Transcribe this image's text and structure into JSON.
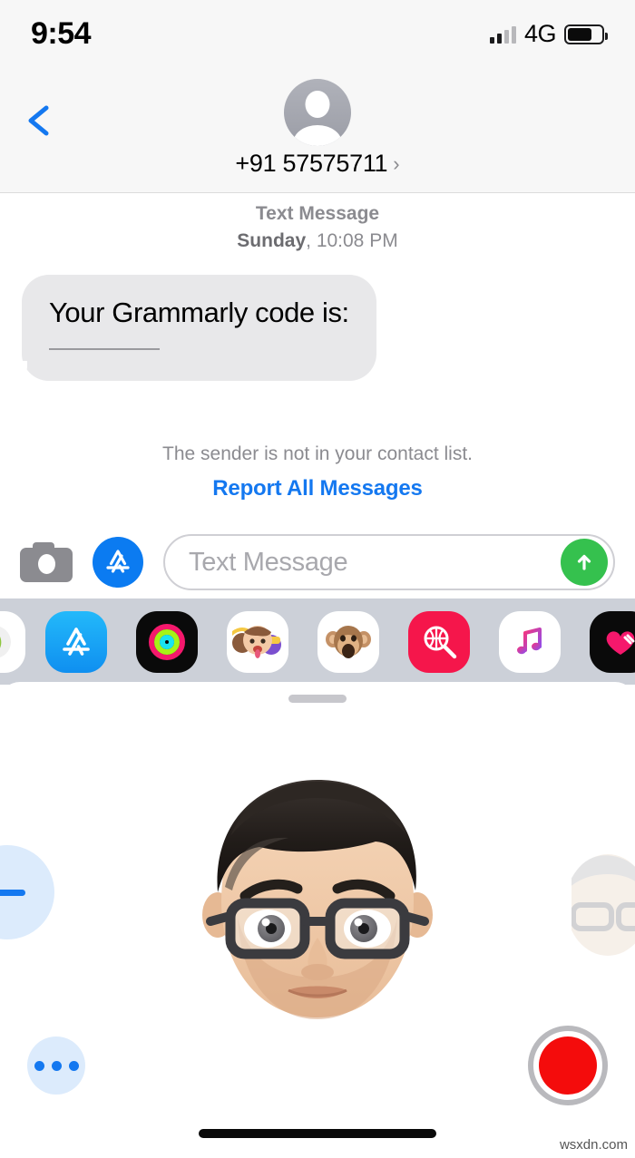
{
  "statusbar": {
    "time": "9:54",
    "network": "4G",
    "signal_bars_active": 2,
    "signal_bars_total": 4,
    "battery_percent": 72,
    "signal_icon": "cellular-signal-icon",
    "battery_icon": "battery-icon"
  },
  "navbar": {
    "back_icon": "back-chevron-icon",
    "avatar_icon": "contact-avatar-placeholder-icon",
    "contact_name": "+91 57575711",
    "detail_arrow": "›"
  },
  "conversation": {
    "message_kind": "Text Message",
    "day": "Sunday",
    "time_separator": ", ",
    "time": "10:08 PM",
    "bubble_text": "Your Grammarly code is:",
    "redacted": true,
    "notice": "The sender is not in your contact list.",
    "report_link": "Report All Messages"
  },
  "inputbar": {
    "camera_icon": "camera-icon",
    "appstore_icon": "app-store-icon",
    "placeholder": "Text Message",
    "value": "",
    "send_icon": "send-arrow-up-icon"
  },
  "appdrawer": {
    "items": [
      {
        "name": "app-icon-partial-left",
        "label": "",
        "bg": "#ffffff",
        "glyph": "",
        "partial": true
      },
      {
        "name": "app-icon-app-store",
        "label": "App Store",
        "bg": "#1ba7f5",
        "glyph": "appstore"
      },
      {
        "name": "app-icon-activity",
        "label": "Activity",
        "bg": "#0a0a0a",
        "glyph": "rings"
      },
      {
        "name": "app-icon-memoji-stickers",
        "label": "Memoji Stickers",
        "bg": "#ffffff",
        "glyph": "memojis"
      },
      {
        "name": "app-icon-animoji",
        "label": "Animoji",
        "bg": "#ffffff",
        "glyph": "monkey"
      },
      {
        "name": "app-icon-images",
        "label": "#images",
        "bg": "#f5164b",
        "glyph": "search-globe"
      },
      {
        "name": "app-icon-music",
        "label": "Music",
        "bg": "#ffffff",
        "glyph": "note"
      },
      {
        "name": "app-icon-health",
        "label": "Health",
        "bg": "#0a0a0a",
        "glyph": "heart",
        "partial": true
      }
    ]
  },
  "memoji_panel": {
    "grabber_name": "drawer-grabber",
    "add_memoji_label": "New Memoji",
    "more_button_label": "More options",
    "record_button_label": "Record",
    "memoji_description": "Memoji with dark hair, black rectangular glasses and stubble beard",
    "side_memoji_description": "Adjacent memoji with gray hair and glasses"
  },
  "footer": {
    "home_indicator": "home-indicator",
    "watermark": "wsxdn.com"
  },
  "colors": {
    "accent_blue": "#1478f0",
    "send_green": "#35c14e",
    "bubble_gray": "#e8e8ea",
    "record_red": "#f40c0c",
    "drawer_gray": "#ccd0d8"
  }
}
